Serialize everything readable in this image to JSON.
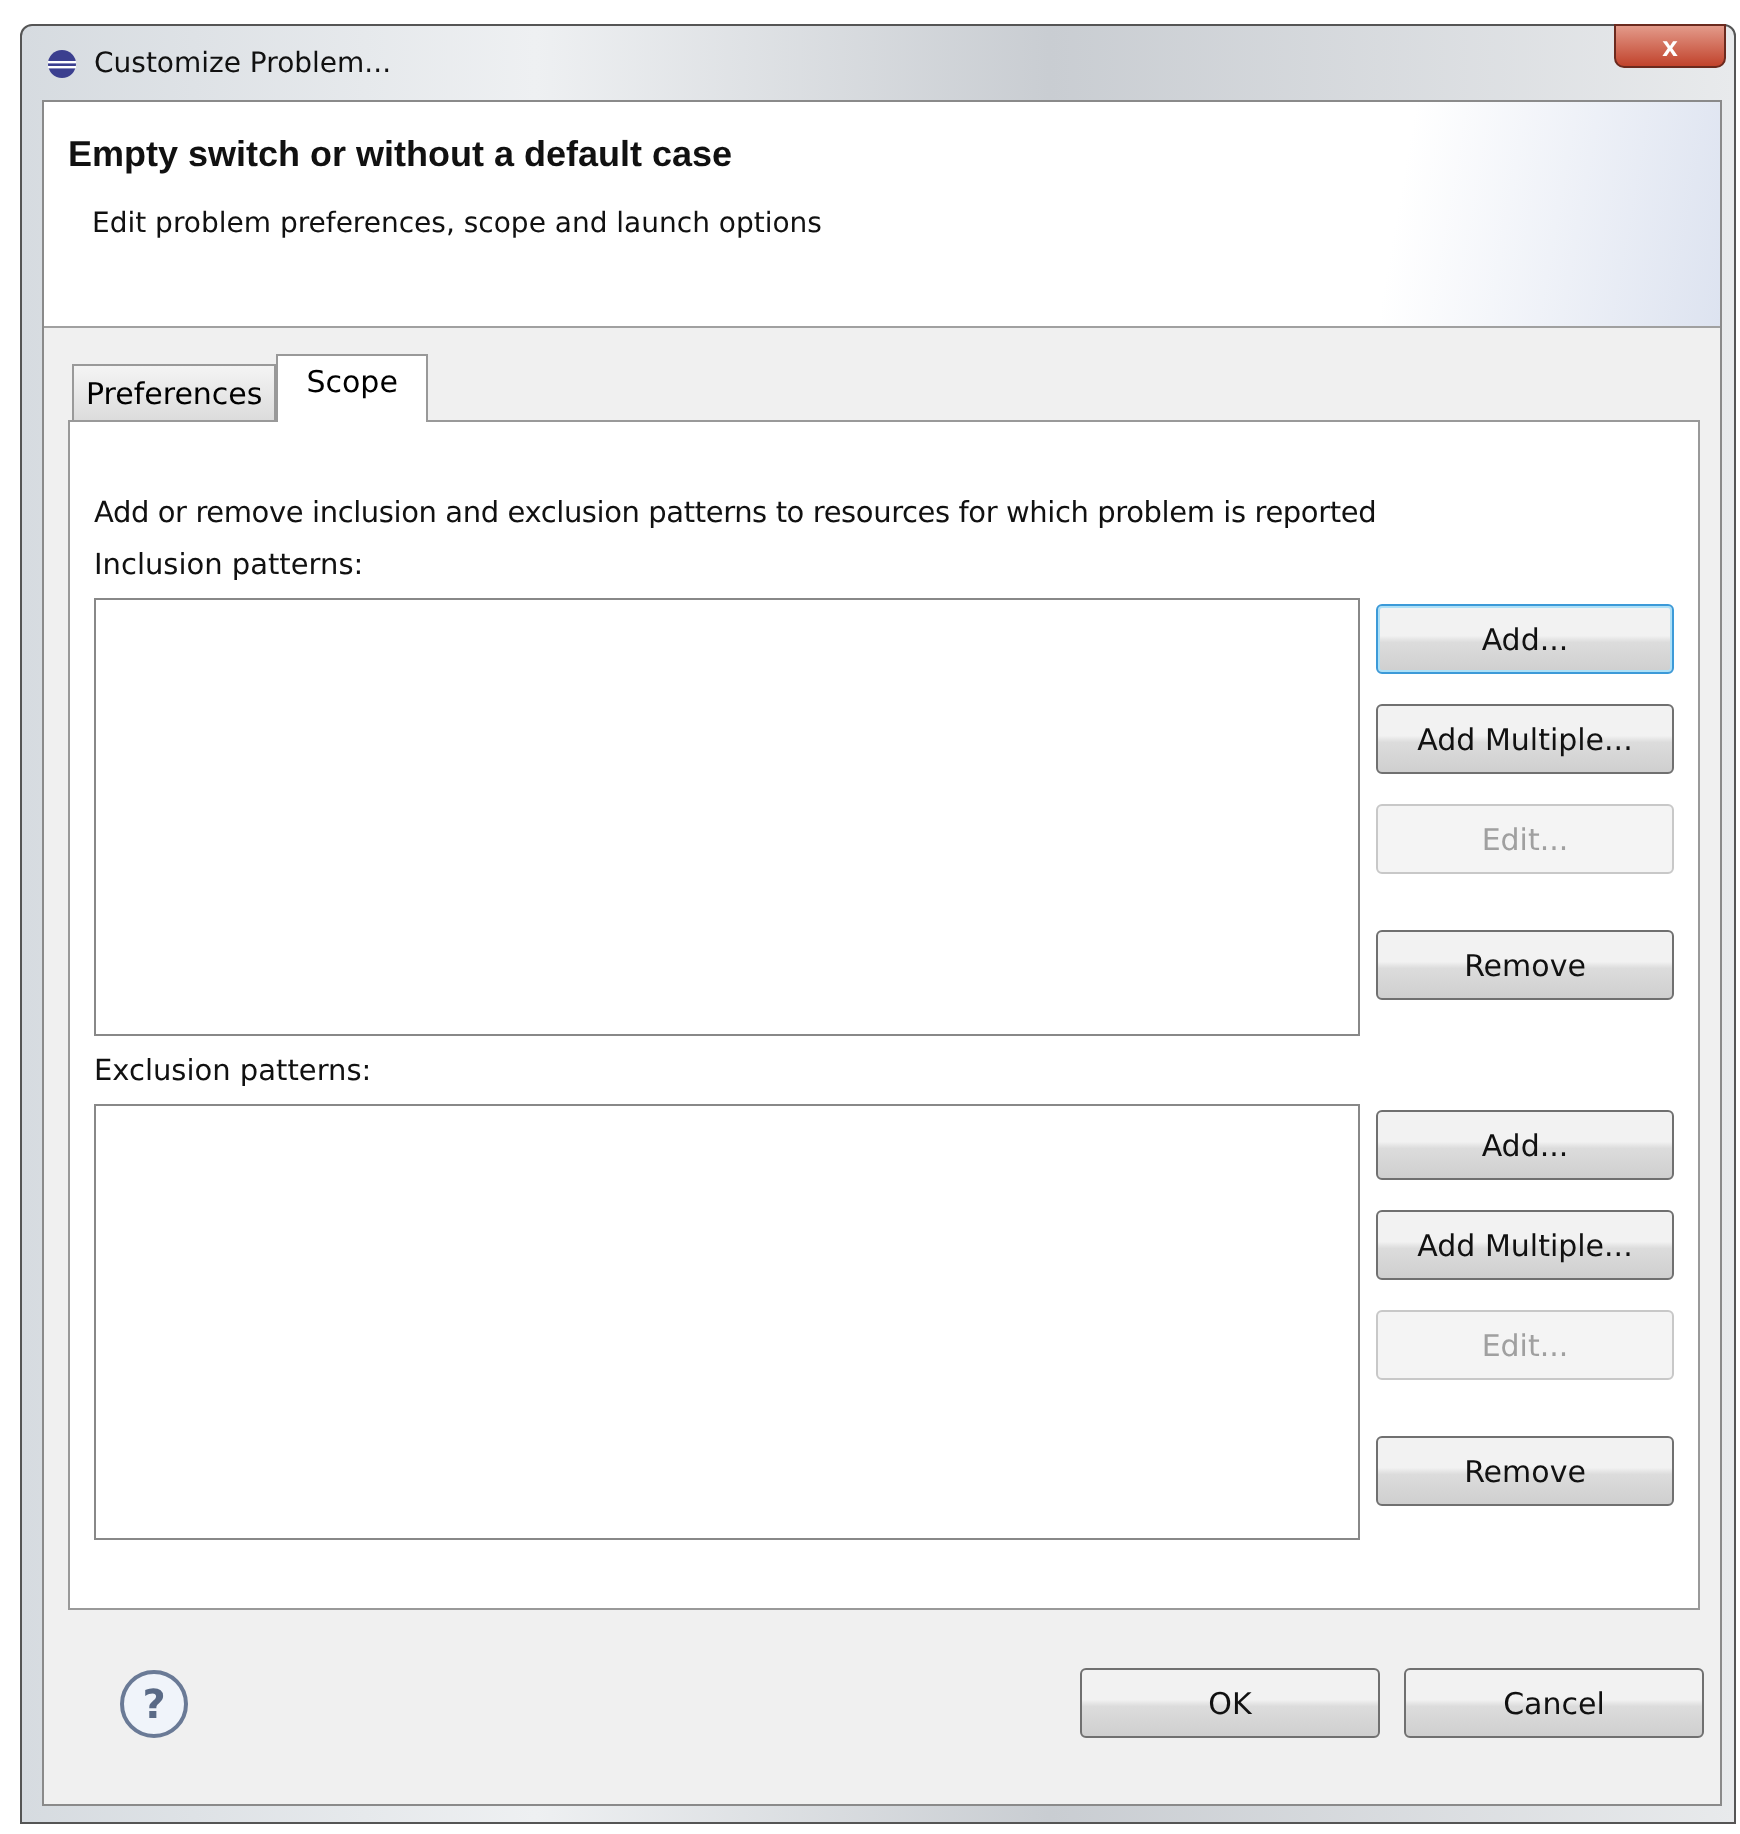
{
  "window": {
    "title": "Customize Problem...",
    "close_label": "x"
  },
  "header": {
    "title": "Empty switch or without a default case",
    "description": "Edit problem preferences, scope and launch options"
  },
  "tabs": [
    {
      "label": "Preferences",
      "selected": false
    },
    {
      "label": "Scope",
      "selected": true
    }
  ],
  "scope": {
    "intro": "Add or remove inclusion and exclusion patterns to resources for which problem is reported",
    "groups": [
      {
        "label": "Inclusion patterns:",
        "buttons": [
          {
            "label": "Add...",
            "focused": true,
            "disabled": false
          },
          {
            "label": "Add Multiple...",
            "focused": false,
            "disabled": false
          },
          {
            "label": "Edit...",
            "focused": false,
            "disabled": true
          },
          {
            "label": "Remove",
            "focused": false,
            "disabled": false
          }
        ]
      },
      {
        "label": "Exclusion patterns:",
        "buttons": [
          {
            "label": "Add...",
            "focused": false,
            "disabled": false
          },
          {
            "label": "Add Multiple...",
            "focused": false,
            "disabled": false
          },
          {
            "label": "Edit...",
            "focused": false,
            "disabled": true
          },
          {
            "label": "Remove",
            "focused": false,
            "disabled": false
          }
        ]
      }
    ]
  },
  "footer": {
    "help": "?",
    "buttons": [
      "OK",
      "Cancel"
    ]
  }
}
